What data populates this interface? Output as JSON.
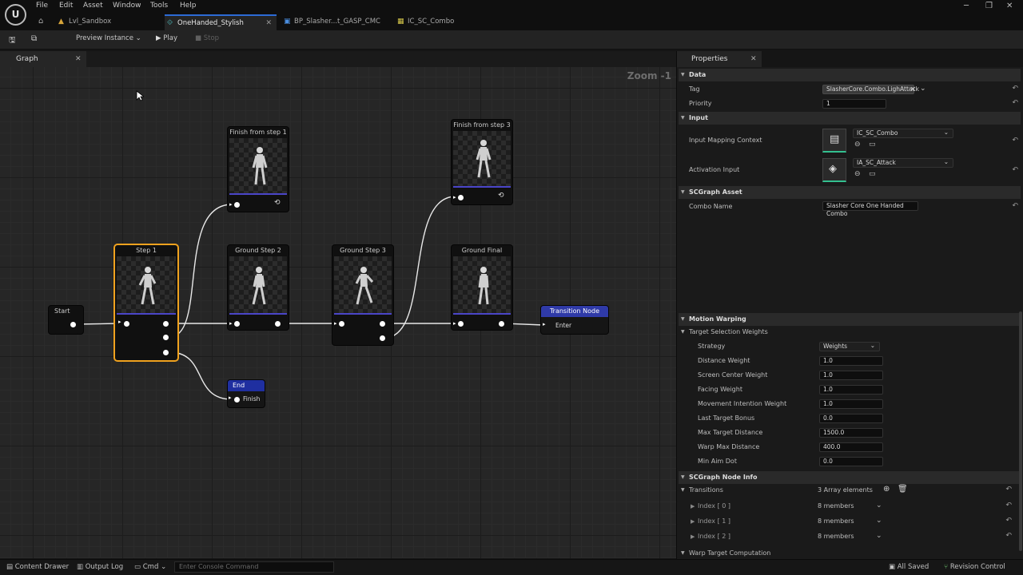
{
  "menu": [
    "File",
    "Edit",
    "Asset",
    "Window",
    "Tools",
    "Help"
  ],
  "doc_tabs": [
    {
      "label": "Lvl_Sandbox",
      "icon": "level-icon"
    },
    {
      "label": "OneHanded_Stylish",
      "icon": "graph-icon"
    },
    {
      "label": "BP_Slasher...t_GASP_CMC",
      "icon": "blueprint-icon"
    },
    {
      "label": "IC_SC_Combo",
      "icon": "input-context-icon"
    }
  ],
  "toolbar": {
    "preview_instance": "Preview Instance",
    "play": "Play",
    "stop": "Stop"
  },
  "graph": {
    "tab_label": "Graph",
    "zoom": "Zoom -1",
    "nodes": {
      "start": "Start",
      "step1": "Step 1",
      "finish1": "Finish from step 1",
      "ground2": "Ground Step 2",
      "ground3": "Ground Step 3",
      "finish3": "Finish from step 3",
      "ground_final": "Ground Final",
      "transition": "Transition Node",
      "transition_pin": "Enter",
      "end": "End",
      "end_pin": "Finish"
    },
    "colors": {
      "selected": "#f0a21e",
      "node_accent": "#4a45c8",
      "transition_header": "#2f3aa8",
      "end_header": "#1f2fa0"
    }
  },
  "properties": {
    "tab_label": "Properties",
    "data": {
      "title": "Data",
      "tag_label": "Tag",
      "tag_value": "SlasherCore.Combo.LighAttack",
      "priority_label": "Priority",
      "priority_value": "1"
    },
    "input": {
      "title": "Input",
      "mapping_label": "Input Mapping Context",
      "mapping_value": "IC_SC_Combo",
      "activation_label": "Activation Input",
      "activation_value": "IA_SC_Attack"
    },
    "asset": {
      "title": "SCGraph Asset",
      "combo_label": "Combo Name",
      "combo_value": "Slasher Core One Handed Combo"
    },
    "motion": {
      "title": "Motion Warping",
      "sub_title": "Target Selection Weights",
      "rows": [
        {
          "label": "Strategy",
          "value": "Weights"
        },
        {
          "label": "Distance Weight",
          "value": "1.0"
        },
        {
          "label": "Screen Center Weight",
          "value": "1.0"
        },
        {
          "label": "Facing Weight",
          "value": "1.0"
        },
        {
          "label": "Movement Intention Weight",
          "value": "1.0"
        },
        {
          "label": "Last Target Bonus",
          "value": "0.0"
        },
        {
          "label": "Max Target Distance",
          "value": "1500.0"
        },
        {
          "label": "Warp Max Distance",
          "value": "400.0"
        },
        {
          "label": "Min Aim Dot",
          "value": "0.0"
        }
      ]
    },
    "node_info": {
      "title": "SCGraph Node Info",
      "transitions_label": "Transitions",
      "transitions_value": "3 Array elements",
      "indices": [
        {
          "label": "Index [ 0 ]",
          "value": "8 members"
        },
        {
          "label": "Index [ 1 ]",
          "value": "8 members"
        },
        {
          "label": "Index [ 2 ]",
          "value": "8 members"
        }
      ],
      "warp_title": "Warp Target Computation"
    }
  },
  "statusbar": {
    "content_drawer": "Content Drawer",
    "output_log": "Output Log",
    "cmd": "Cmd",
    "console_placeholder": "Enter Console Command",
    "all_saved": "All Saved",
    "revision_control": "Revision Control"
  }
}
